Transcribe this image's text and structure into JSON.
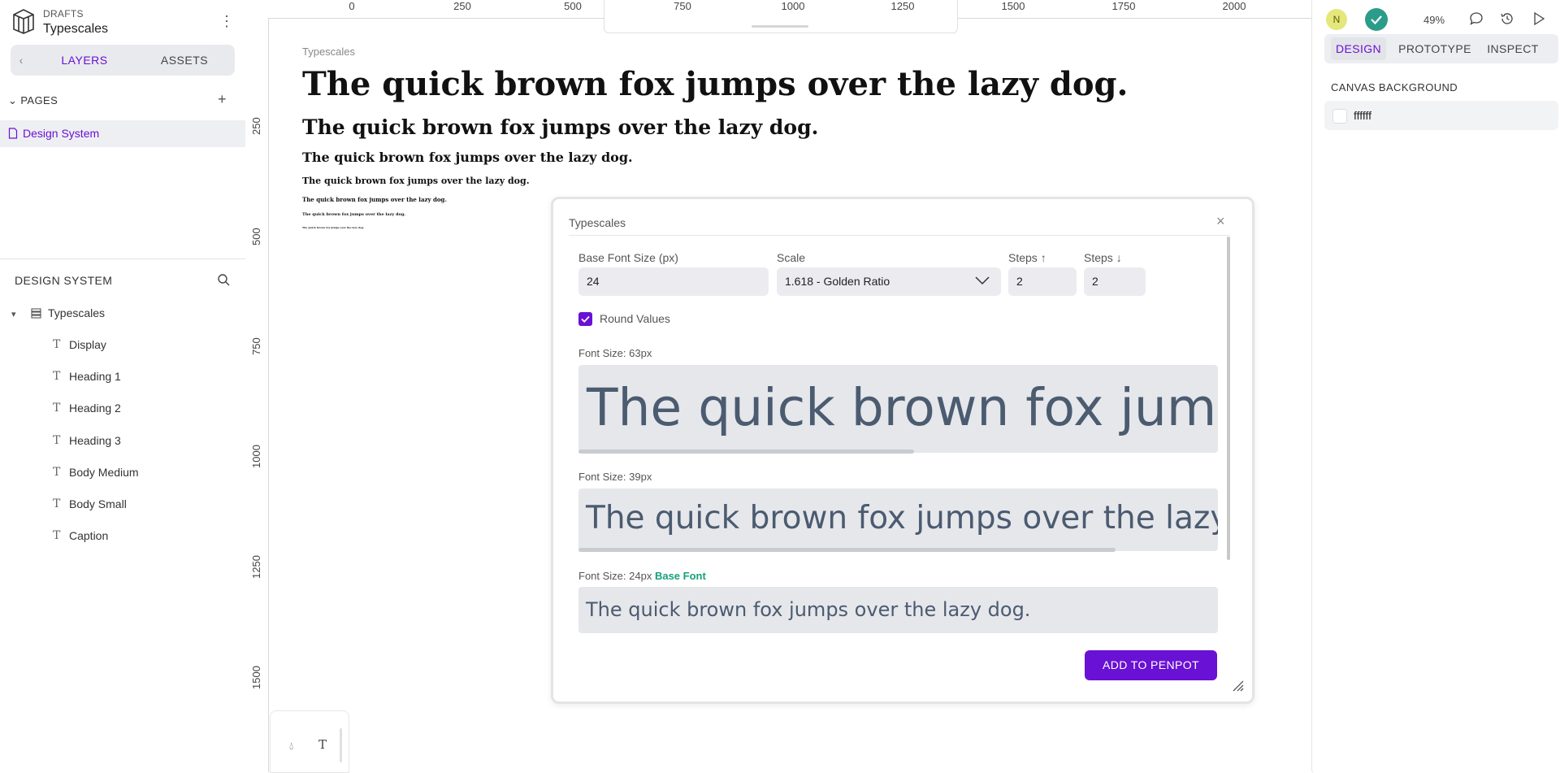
{
  "left": {
    "header": {
      "section": "DRAFTS",
      "title": "Typescales"
    },
    "tabs": {
      "back": "‹",
      "layers": "LAYERS",
      "assets": "ASSETS"
    },
    "pages": {
      "heading": "PAGES",
      "add": "+",
      "items": [
        {
          "label": "Design System"
        }
      ]
    },
    "layers": {
      "heading": "DESIGN SYSTEM",
      "board": "Typescales",
      "items": [
        {
          "label": "Display"
        },
        {
          "label": "Heading 1"
        },
        {
          "label": "Heading 2"
        },
        {
          "label": "Heading 3"
        },
        {
          "label": "Body Medium"
        },
        {
          "label": "Body Small"
        },
        {
          "label": "Caption"
        }
      ],
      "text_glyph": "T"
    }
  },
  "canvas": {
    "ruler_top": [
      "0",
      "250",
      "500",
      "750",
      "1000",
      "1250",
      "1500",
      "1750",
      "2000"
    ],
    "ruler_left": [
      "250",
      "500",
      "750",
      "1000",
      "1250",
      "1500"
    ],
    "board_title": "Typescales",
    "samples": [
      "The quick brown fox jumps over the lazy dog.",
      "The quick brown fox jumps over the lazy dog.",
      "The quick brown fox jumps over the lazy dog.",
      "The quick brown fox jumps over the lazy dog.",
      "The quick brown fox jumps over the lazy dog.",
      "The quick brown fox jumps over the lazy dog.",
      "The quick brown fox jumps over the lazy dog."
    ]
  },
  "right": {
    "avatar": "N",
    "zoom": "49%",
    "tabs": {
      "design": "DESIGN",
      "prototype": "PROTOTYPE",
      "inspect": "INSPECT"
    },
    "canvas_background": {
      "heading": "CANVAS BACKGROUND",
      "value": "ffffff"
    }
  },
  "plugin": {
    "title": "Typescales",
    "close": "×",
    "fields": {
      "base_label": "Base Font Size (px)",
      "base_value": "24",
      "scale_label": "Scale",
      "scale_value": "1.618 - Golden Ratio",
      "steps_up_label": "Steps ↑",
      "steps_up_value": "2",
      "steps_down_label": "Steps ↓",
      "steps_down_value": "2"
    },
    "round_values": {
      "label": "Round Values",
      "checked": true
    },
    "previews": [
      {
        "label": "Font Size: 63px",
        "tag": "",
        "text": "The quick brown fox jumps over the lazy dog."
      },
      {
        "label": "Font Size: 39px",
        "tag": "",
        "text": "The quick brown fox jumps over the lazy dog."
      },
      {
        "label": "Font Size: 24px",
        "tag": "Base Font",
        "text": "The quick brown fox jumps over the lazy dog."
      }
    ],
    "add_button": "ADD TO PENPOT"
  },
  "colors": {
    "accent": "#6911d4",
    "base_tag": "#18a07a",
    "check": "#2b9c8a"
  }
}
